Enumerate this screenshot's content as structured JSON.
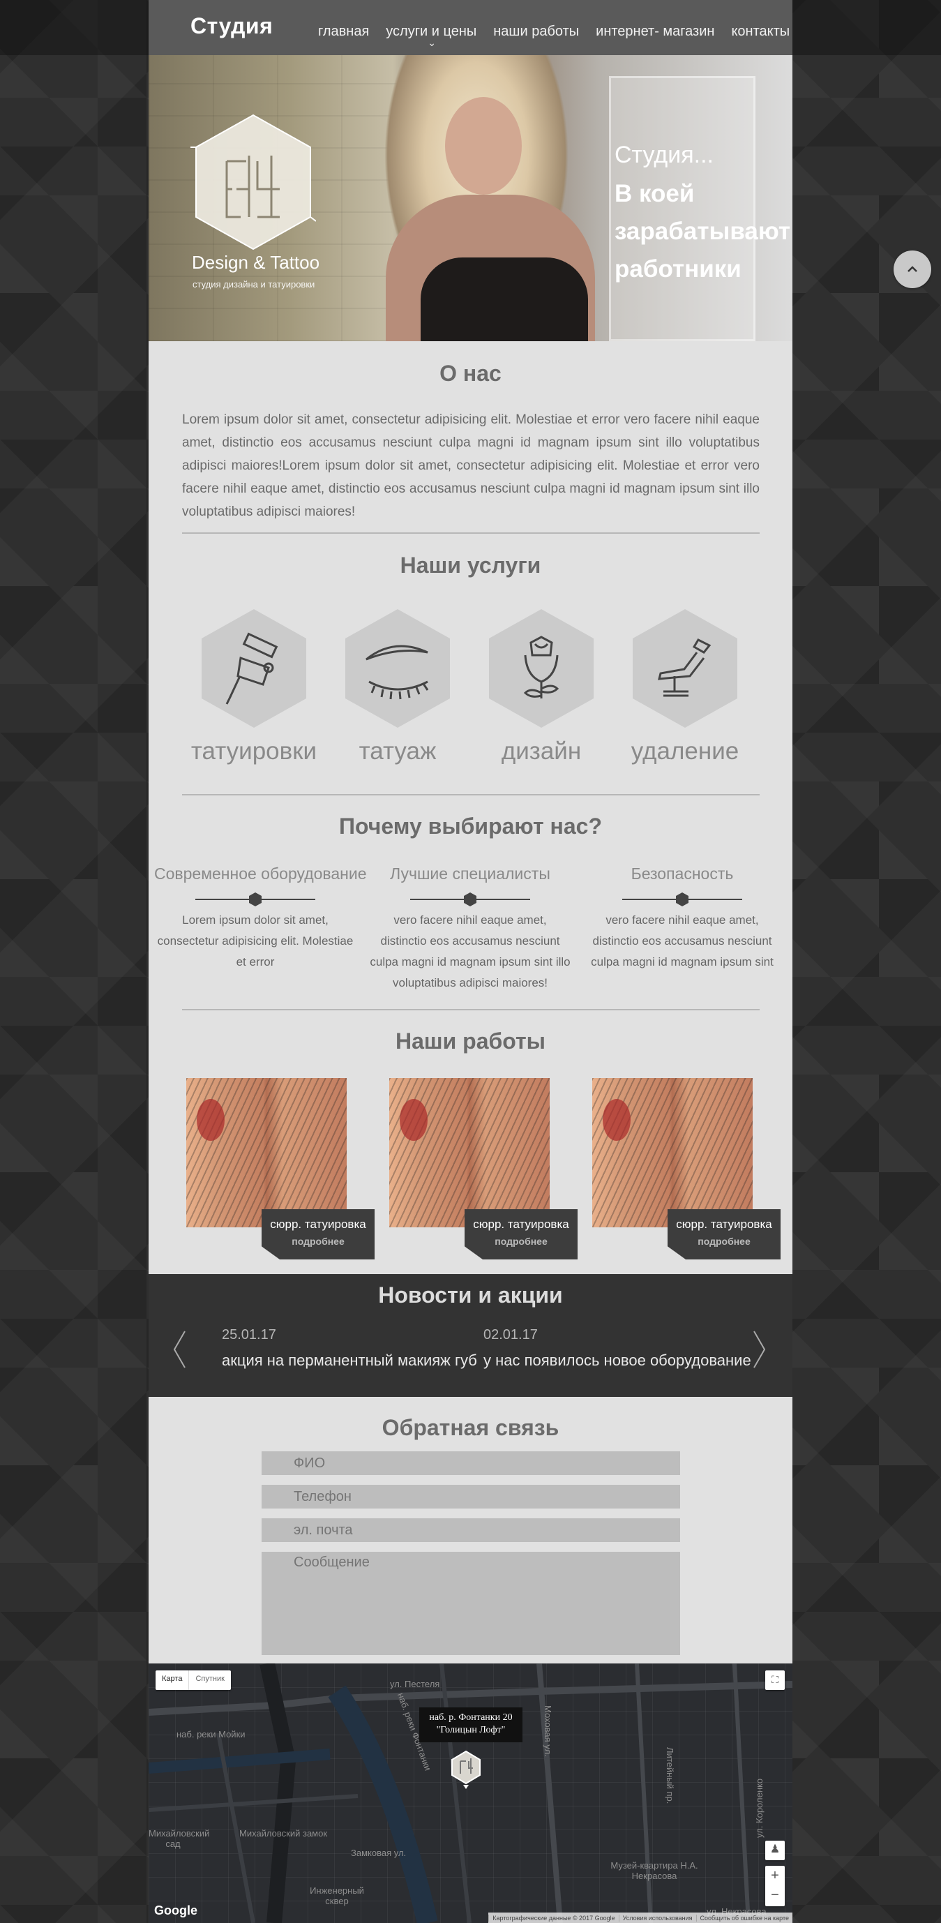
{
  "header": {
    "logo": "Студия",
    "nav": [
      "главная",
      "услуги и цены",
      "наши работы",
      "интернет- магазин",
      "контакты"
    ]
  },
  "hero": {
    "emblem_title": "Design & Tattoo",
    "emblem_subtitle": "студия дизайна и татуировки",
    "slogan_small": "Студия...",
    "slogan_big": "В коей зарабатывают работники"
  },
  "about": {
    "title": "О нас",
    "text": "Lorem ipsum dolor sit amet, consectetur adipisicing elit. Molestiae et error vero facere nihil eaque amet, distinctio eos accusamus nesciunt culpa magni id magnam ipsum sint illo voluptatibus adipisci maiores!Lorem ipsum dolor sit amet, consectetur adipisicing elit. Molestiae et error vero facere nihil eaque amet, distinctio eos accusamus nesciunt culpa magni id magnam ipsum sint illo voluptatibus adipisci maiores!"
  },
  "services": {
    "title": "Наши услуги",
    "items": [
      {
        "label": "татуировки",
        "icon": "tattoo-machine-icon"
      },
      {
        "label": "татуаж",
        "icon": "eyebrow-eyelash-icon"
      },
      {
        "label": "дизайн",
        "icon": "rose-icon"
      },
      {
        "label": "удаление",
        "icon": "tattoo-chair-icon"
      }
    ]
  },
  "why": {
    "title": "Почему выбирают нас?",
    "items": [
      {
        "title": "Современное оборудование",
        "text": "Lorem ipsum dolor sit amet, consectetur adipisicing elit. Molestiae et error"
      },
      {
        "title": "Лучшие специалисты",
        "text": "vero facere nihil eaque amet, distinctio eos accusamus nesciunt culpa magni id magnam ipsum sint illo voluptatibus adipisci maiores!"
      },
      {
        "title": "Безопасность",
        "text": "vero facere nihil eaque amet, distinctio eos accusamus nesciunt culpa magni id magnam ipsum sint"
      }
    ]
  },
  "works": {
    "title": "Наши работы",
    "items": [
      {
        "caption": "сюрр. татуировка",
        "more": "подробнее"
      },
      {
        "caption": "сюрр. татуировка",
        "more": "подробнее"
      },
      {
        "caption": "сюрр. татуировка",
        "more": "подробнее"
      }
    ]
  },
  "news": {
    "title": "Новости и акции",
    "items": [
      {
        "date": "25.01.17",
        "text": "акция на перманентный макияж губ"
      },
      {
        "date": "02.01.17",
        "text": "у нас появилось новое оборудование"
      }
    ]
  },
  "feedback": {
    "title": "Обратная связь",
    "name_placeholder": "ФИО",
    "phone_placeholder": "Телефон",
    "email_placeholder": "эл. почта",
    "message_placeholder": "Сообщение"
  },
  "map": {
    "type_map": "Карта",
    "type_satellite": "Спутник",
    "marker_line1": "наб. р. Фонтанки 20",
    "marker_line2": "\"Голицын Лофт\"",
    "labels": [
      "ул. Пестеля",
      "наб. реки Мойки",
      "Михайловский сад",
      "Михайловский замок",
      "Инженерный сквер",
      "Музей-квартира Н.А. Некрасова",
      "Моховая ул.",
      "Литейный пр.",
      "ул. Короленко",
      "наб. реки Фонтанки",
      "Замковая ул.",
      "ул. Некрасова"
    ],
    "google": "Google",
    "attribution": [
      "Картографические данные © 2017 Google",
      "Условия использования",
      "Сообщить об ошибке на карте"
    ]
  },
  "colors": {
    "panel": "#e1e1e1",
    "dark": "#333333",
    "header": "#5a5a5a",
    "accent_text": "#6b6b6b"
  }
}
